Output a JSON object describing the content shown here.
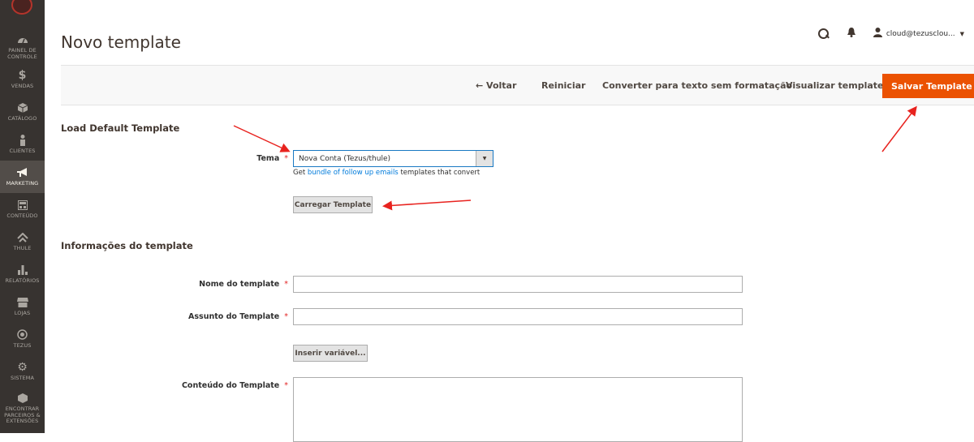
{
  "sidebar": {
    "items": [
      {
        "label": "PAINEL DE\nCONTROLE",
        "icon": "dashboard-icon"
      },
      {
        "label": "VENDAS",
        "icon": "dollar-icon"
      },
      {
        "label": "CATÁLOGO",
        "icon": "box-icon"
      },
      {
        "label": "CLIENTES",
        "icon": "person-icon"
      },
      {
        "label": "MARKETING",
        "icon": "megaphone-icon"
      },
      {
        "label": "CONTEÚDO",
        "icon": "layout-icon"
      },
      {
        "label": "THULE",
        "icon": "thule-icon"
      },
      {
        "label": "RELATÓRIOS",
        "icon": "bar-chart-icon"
      },
      {
        "label": "LOJAS",
        "icon": "store-icon"
      },
      {
        "label": "TEZUS",
        "icon": "tezus-icon"
      },
      {
        "label": "SISTEMA",
        "icon": "gear-icon"
      },
      {
        "label": "ENCONTRAR\nPARCEIROS &\nEXTENSÕES",
        "icon": "cube-icon"
      }
    ]
  },
  "header": {
    "title": "Novo template",
    "user": "cloud@tezusclou..."
  },
  "actionbar": {
    "back": "← Voltar",
    "reset": "Reiniciar",
    "convert": "Converter para texto sem formatação",
    "preview": "Visualizar template",
    "save": "Salvar Template"
  },
  "load_section": {
    "title": "Load Default Template",
    "tema_label": "Tema",
    "tema_value": "Nova Conta (Tezus/thule)",
    "note_prefix": "Get ",
    "note_link": "bundle of follow up emails",
    "note_suffix": " templates that convert",
    "load_button": "Carregar Template"
  },
  "info_section": {
    "title": "Informações do template",
    "name_label": "Nome do template",
    "subject_label": "Assunto do Template",
    "insert_variable": "Inserir variável...",
    "content_label": "Conteúdo do Template"
  },
  "colors": {
    "sidebar_bg": "#373330",
    "accent": "#eb5202",
    "link": "#007bdb",
    "annotation_arrow": "#e8231f"
  }
}
